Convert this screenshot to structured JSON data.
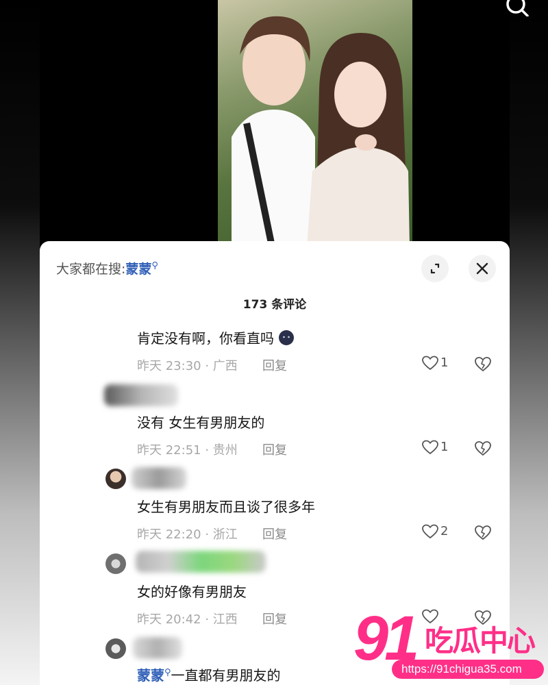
{
  "top_bar": {
    "search_icon": "search-icon"
  },
  "sheet": {
    "hot_search_prefix": "大家都在搜:",
    "hot_search_term": "蒙蒙",
    "hot_search_icon": "search-icon",
    "comment_count": "173 条评论",
    "expand_icon": "expand-icon",
    "close_icon": "close-icon"
  },
  "comments": [
    {
      "text": "肯定没有啊，你看直吗",
      "emoji": "smiling-face-emoji",
      "time": "昨天 23:30 · 广西",
      "reply": "回复",
      "likes": "1"
    },
    {
      "text": "没有 女生有男朋友的",
      "time": "昨天 22:51 · 贵州",
      "reply": "回复",
      "likes": "1"
    },
    {
      "text": "女生有男朋友而且谈了很多年",
      "time": "昨天 22:20 · 浙江",
      "reply": "回复",
      "likes": "2"
    },
    {
      "text": "女的好像有男朋友",
      "time": "昨天 20:42 · 江西",
      "reply": "回复",
      "likes": ""
    },
    {
      "mention": "蒙蒙",
      "text": "一直都有男朋友的"
    }
  ],
  "watermark": {
    "number": "91",
    "name": "吃瓜中心",
    "url": "https://91chigua35.com"
  },
  "colors": {
    "accent": "#2f5fb7",
    "watermark": "#ff2f88",
    "meta": "#a7a7a7"
  }
}
